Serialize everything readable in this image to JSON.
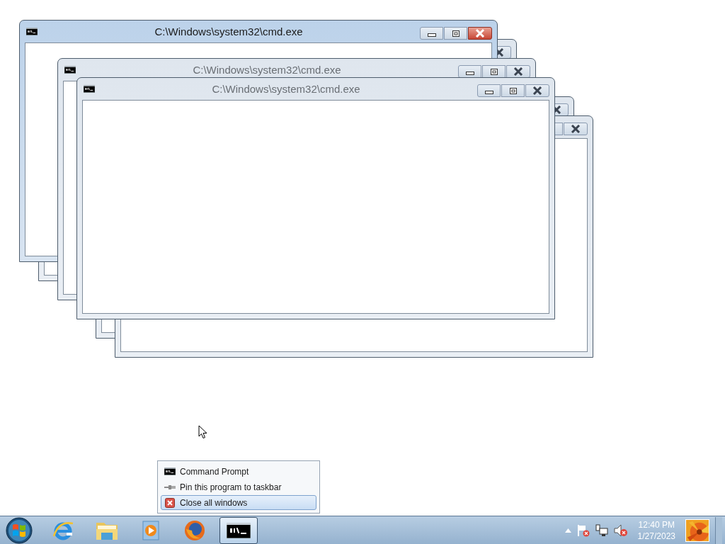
{
  "windows": [
    {
      "title": "C:\\Windows\\system32\\cmd.exe",
      "active": true
    },
    {
      "active": false
    },
    {
      "title": "C:\\Windows\\system32\\cmd.exe",
      "active": false
    },
    {
      "title": "C:\\Windows\\system32\\cmd.exe",
      "active": false
    },
    {
      "active": false
    },
    {
      "active": false
    }
  ],
  "jump_list": {
    "items": [
      {
        "kind": "app",
        "label": "Command Prompt",
        "selected": false
      },
      {
        "kind": "pin",
        "label": "Pin this program to taskbar",
        "selected": false
      },
      {
        "kind": "close",
        "label": "Close all windows",
        "selected": true
      }
    ]
  },
  "taskbar": {
    "items": [
      {
        "kind": "start",
        "selected": false
      },
      {
        "kind": "browser",
        "selected": false
      },
      {
        "kind": "folder",
        "selected": false
      },
      {
        "kind": "media",
        "selected": false
      },
      {
        "kind": "firefox",
        "selected": false
      },
      {
        "kind": "console",
        "selected": true
      }
    ],
    "tray": {
      "time": "12:40 PM",
      "date": "1/27/2023"
    }
  }
}
